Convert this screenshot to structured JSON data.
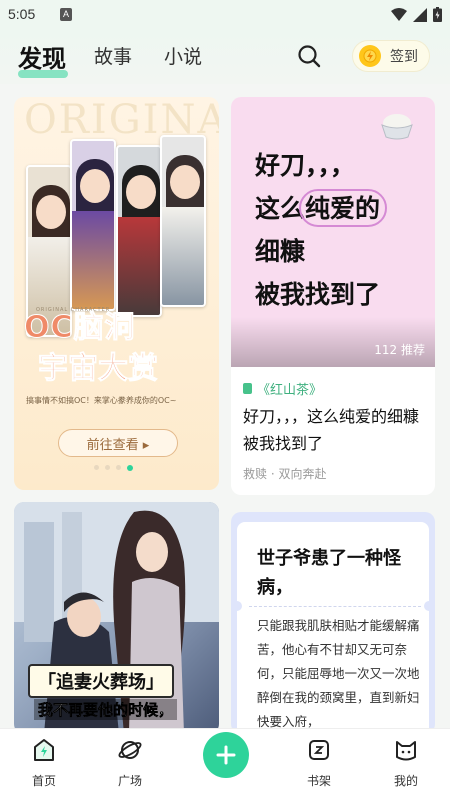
{
  "status_bar": {
    "time": "5:05",
    "app_icon_letter": "A"
  },
  "header": {
    "tabs": [
      {
        "label": "发现",
        "active": true
      },
      {
        "label": "故事",
        "active": false
      },
      {
        "label": "小说",
        "active": false
      }
    ],
    "signin_label": "签到",
    "accent": "#2ed39a"
  },
  "banner": {
    "bg_text": "ORIGINAL",
    "subtitle": "ORIGINAL CHARACTER",
    "title_line1": "OC脑洞",
    "title_line2": "宇宙大赏",
    "sub": "搞事情不如搞OC！来掌心豢养成你的OC~",
    "button": "前往查看 ▸",
    "page_dots": 4,
    "active_dot": 3
  },
  "post": {
    "cover_lines": [
      "好刀，，，",
      "这么",
      "纯爱的",
      "细糠",
      "被我找到了"
    ],
    "recommend": "112 推荐",
    "tag": "《红山茶》",
    "title": "好刀，，，这么纯爱的细糠被我找到了",
    "meta": "救赎 · 双向奔赴"
  },
  "story_image": {
    "line1": "「追妻火葬场」",
    "line2": "我不再要他的时候，"
  },
  "story_text": {
    "title": "世子爷患了一种怪病，",
    "body": "只能跟我肌肤相贴才能缓解痛苦，他心有不甘却又无可奈何，只能屈辱地一次又一次地醉倒在我的颈窝里，直到新妇快要入府，"
  },
  "bottom_nav": {
    "items": [
      {
        "label": "首页"
      },
      {
        "label": "广场"
      },
      {
        "label": "书架"
      },
      {
        "label": "我的"
      }
    ]
  }
}
